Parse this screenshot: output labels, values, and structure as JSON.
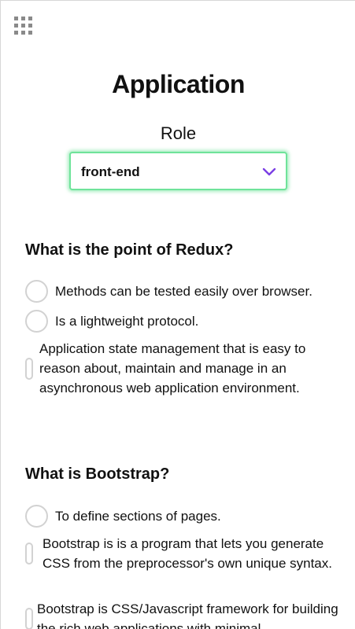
{
  "header": {
    "menu_icon": "grid-menu-icon",
    "title": "Application"
  },
  "role": {
    "label": "Role",
    "selected": "front-end",
    "chevron_icon": "chevron-down-icon",
    "chevron_color": "#7b3fe4",
    "focus_color": "#6fe39a"
  },
  "questions": [
    {
      "text": "What is the point of Redux?",
      "options": [
        "Methods can be tested easily over browser.",
        "Is a lightweight protocol.",
        "Application state management that is easy to reason about, maintain and manage in an asynchronous web application environment."
      ]
    },
    {
      "text": "What is Bootstrap?",
      "options": [
        "To define sections of pages.",
        "Bootstrap is is a program that lets you generate CSS from the preprocessor's own unique syntax.",
        "Bootstrap is CSS/Javascript framework for building the rich web applications with minimal"
      ]
    }
  ]
}
